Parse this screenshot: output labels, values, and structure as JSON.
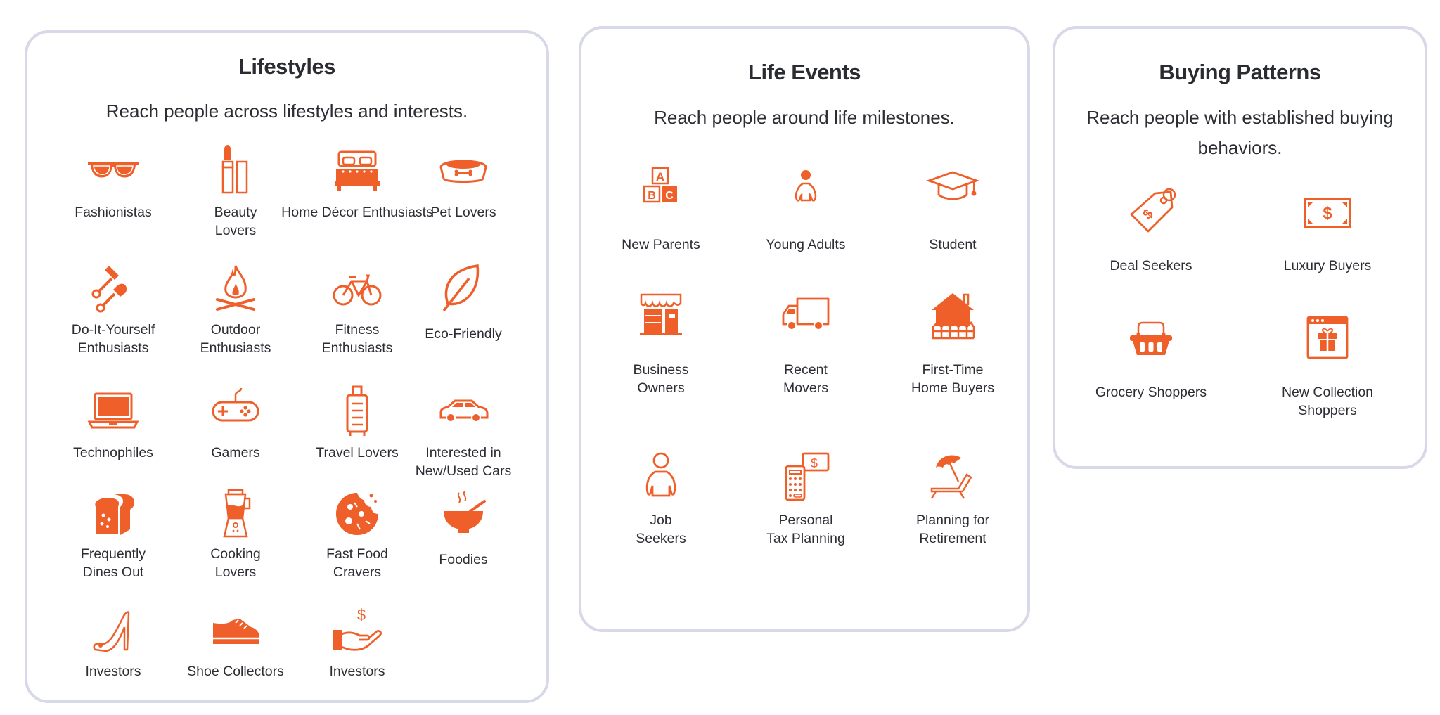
{
  "accent_color": "#ee5f2a",
  "border_color": "#d7d8e8",
  "cards": [
    {
      "title": "Lifestyles",
      "subtitle": "Reach people across lifestyles and interests.",
      "items": [
        {
          "label": "Fashionistas",
          "icon": "sunglasses-icon"
        },
        {
          "label": "Beauty\nLovers",
          "icon": "lipstick-icon"
        },
        {
          "label": "Home Décor Enthusiasts",
          "icon": "bed-icon"
        },
        {
          "label": "Pet Lovers",
          "icon": "pet-bowl-icon"
        },
        {
          "label": "Do-It-Yourself\nEnthusiasts",
          "icon": "garden-tools-icon"
        },
        {
          "label": "Outdoor\nEnthusiasts",
          "icon": "campfire-icon"
        },
        {
          "label": "Fitness\nEnthusiasts",
          "icon": "bicycle-icon"
        },
        {
          "label": "Eco-Friendly",
          "icon": "leaf-icon"
        },
        {
          "label": "Technophiles",
          "icon": "laptop-icon"
        },
        {
          "label": "Gamers",
          "icon": "gamepad-icon"
        },
        {
          "label": "Travel Lovers",
          "icon": "suitcase-icon"
        },
        {
          "label": "Interested in\nNew/Used Cars",
          "icon": "car-icon"
        },
        {
          "label": "Frequently\nDines Out",
          "icon": "bread-icon"
        },
        {
          "label": "Cooking\nLovers",
          "icon": "blender-icon"
        },
        {
          "label": "Fast Food\nCravers",
          "icon": "cookie-icon"
        },
        {
          "label": "Foodies",
          "icon": "soup-bowl-icon"
        },
        {
          "label": "Investors",
          "icon": "high-heel-icon"
        },
        {
          "label": "Shoe Collectors",
          "icon": "sneaker-icon"
        },
        {
          "label": "Investors",
          "icon": "hand-dollar-icon"
        }
      ]
    },
    {
      "title": "Life Events",
      "subtitle": "Reach people around life milestones.",
      "items": [
        {
          "label": "New Parents",
          "icon": "abc-blocks-icon"
        },
        {
          "label": "Young Adults",
          "icon": "person-icon"
        },
        {
          "label": "Student",
          "icon": "graduation-cap-icon"
        },
        {
          "label": "Business\nOwners",
          "icon": "storefront-icon"
        },
        {
          "label": "Recent\nMovers",
          "icon": "moving-truck-icon"
        },
        {
          "label": "First-Time\nHome Buyers",
          "icon": "house-icon"
        },
        {
          "label": "Job\nSeekers",
          "icon": "person-outline-icon"
        },
        {
          "label": "Personal\nTax Planning",
          "icon": "calculator-dollar-icon"
        },
        {
          "label": "Planning for\nRetirement",
          "icon": "beach-chair-icon"
        }
      ]
    },
    {
      "title": "Buying Patterns",
      "subtitle": "Reach people with established buying behaviors.",
      "items": [
        {
          "label": "Deal Seekers",
          "icon": "price-tag-icon"
        },
        {
          "label": "Luxury Buyers",
          "icon": "banknote-icon"
        },
        {
          "label": "Grocery Shoppers",
          "icon": "basket-icon"
        },
        {
          "label": "New Collection\nShoppers",
          "icon": "gift-window-icon"
        }
      ]
    }
  ]
}
